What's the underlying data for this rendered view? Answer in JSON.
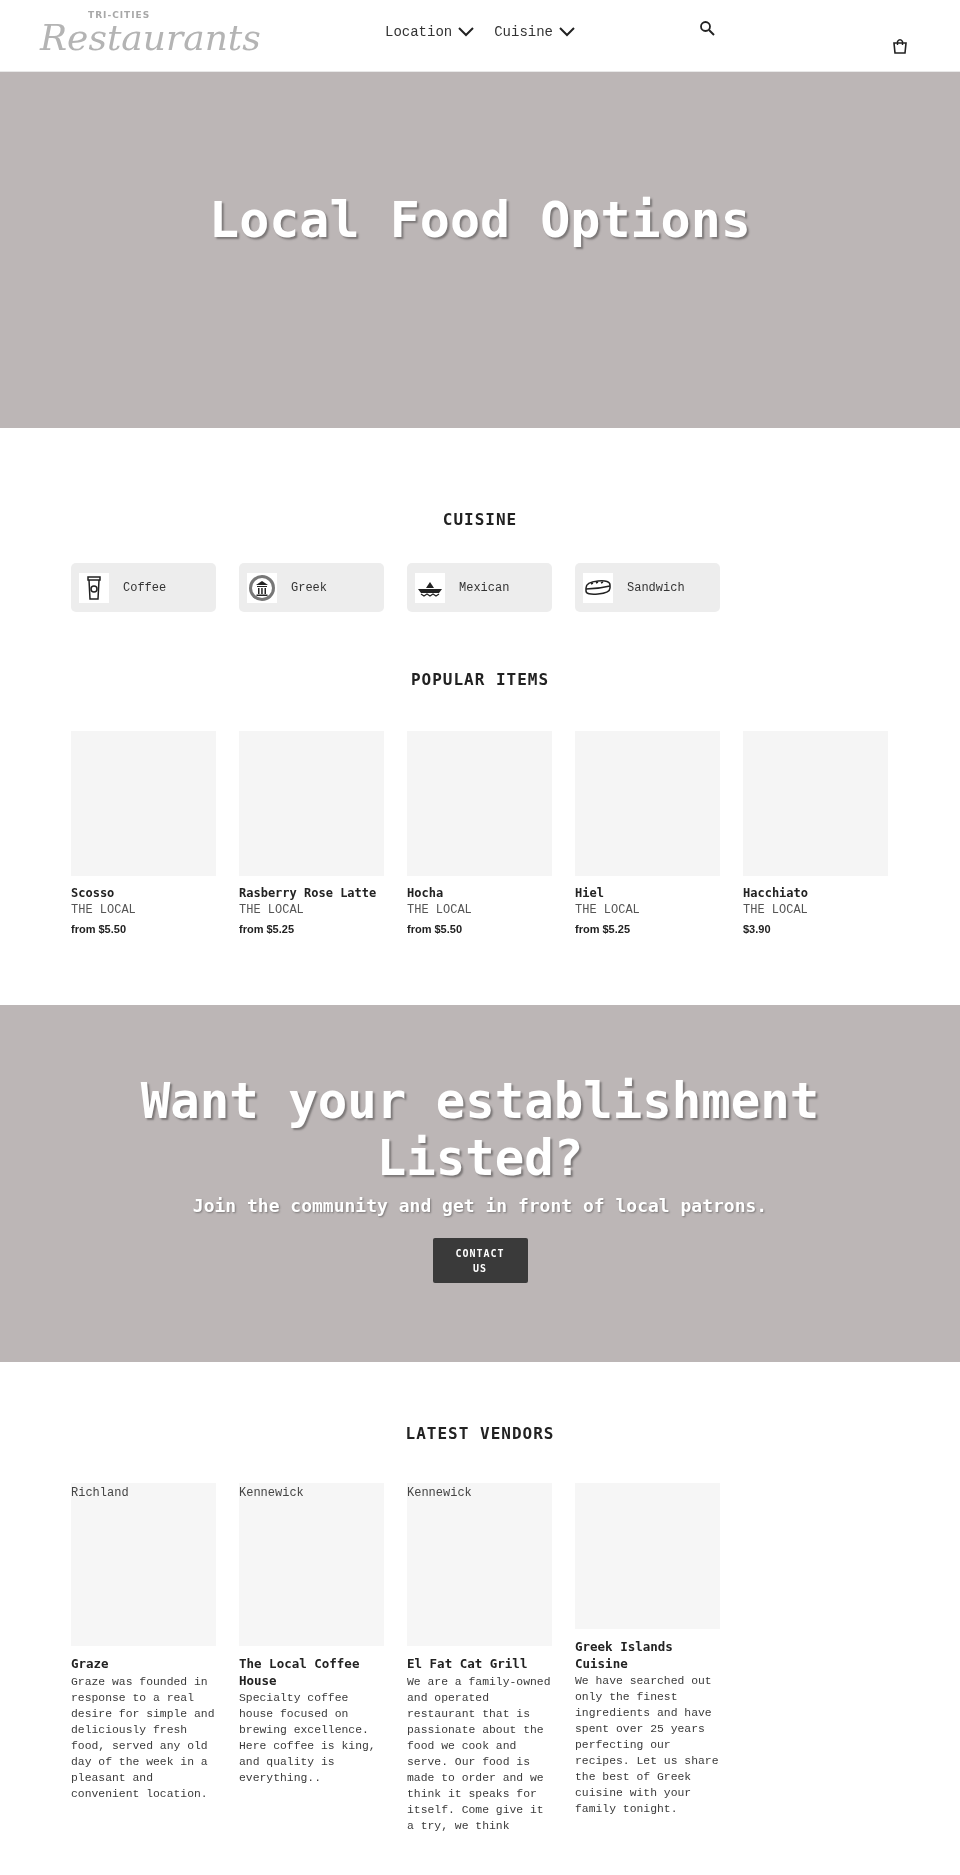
{
  "header": {
    "logo": {
      "small": "TRI-CITIES",
      "script": "Restaurants"
    },
    "nav": [
      {
        "label": "Location"
      },
      {
        "label": "Cuisine"
      }
    ]
  },
  "hero": {
    "title": "Local Food Options"
  },
  "cuisine": {
    "heading": "CUISINE",
    "items": [
      {
        "label": "Coffee",
        "kind": "coffee"
      },
      {
        "label": "Greek",
        "kind": "greek"
      },
      {
        "label": "Mexican",
        "kind": "mexican"
      },
      {
        "label": "Sandwich",
        "kind": "sandwich"
      }
    ]
  },
  "popular": {
    "heading": "POPULAR ITEMS",
    "items": [
      {
        "name": "Scosso",
        "vendor": "THE LOCAL",
        "price": "from $5.50"
      },
      {
        "name": "Rasberry Rose Latte",
        "vendor": "THE LOCAL",
        "price": "from $5.25"
      },
      {
        "name": "Hocha",
        "vendor": "THE LOCAL",
        "price": "from $5.50"
      },
      {
        "name": "Hiel",
        "vendor": "THE LOCAL",
        "price": "from $5.25"
      },
      {
        "name": "Hacchiato",
        "vendor": "THE LOCAL",
        "price": "$3.90"
      }
    ]
  },
  "cta": {
    "title": "Want your establishment Listed?",
    "subtitle": "Join the community and get in front of local patrons.",
    "button": "CONTACT US"
  },
  "vendors": {
    "heading": "LATEST VENDORS",
    "items": [
      {
        "location": "Richland",
        "name": "Graze",
        "description": "Graze was founded in response to a real desire for simple and deliciously fresh food, served any old day of the week in a pleasant and convenient location."
      },
      {
        "location": "Kennewick",
        "name": "The Local Coffee House",
        "description": "Specialty coffee house focused on brewing excellence. Here coffee is king, and quality is everything.."
      },
      {
        "location": "Kennewick",
        "name": "El Fat Cat Grill",
        "description": "We are a family-owned and operated restaurant that is passionate about the food we cook and serve. Our food is made to order and we think it speaks for itself. Come give it a try, we think"
      },
      {
        "name": "Greek Islands Cuisine",
        "description": "We have searched out only the finest ingredients and have spent over 25 years perfecting our recipes. Let us share the best of Greek cuisine with your family tonight."
      }
    ]
  }
}
